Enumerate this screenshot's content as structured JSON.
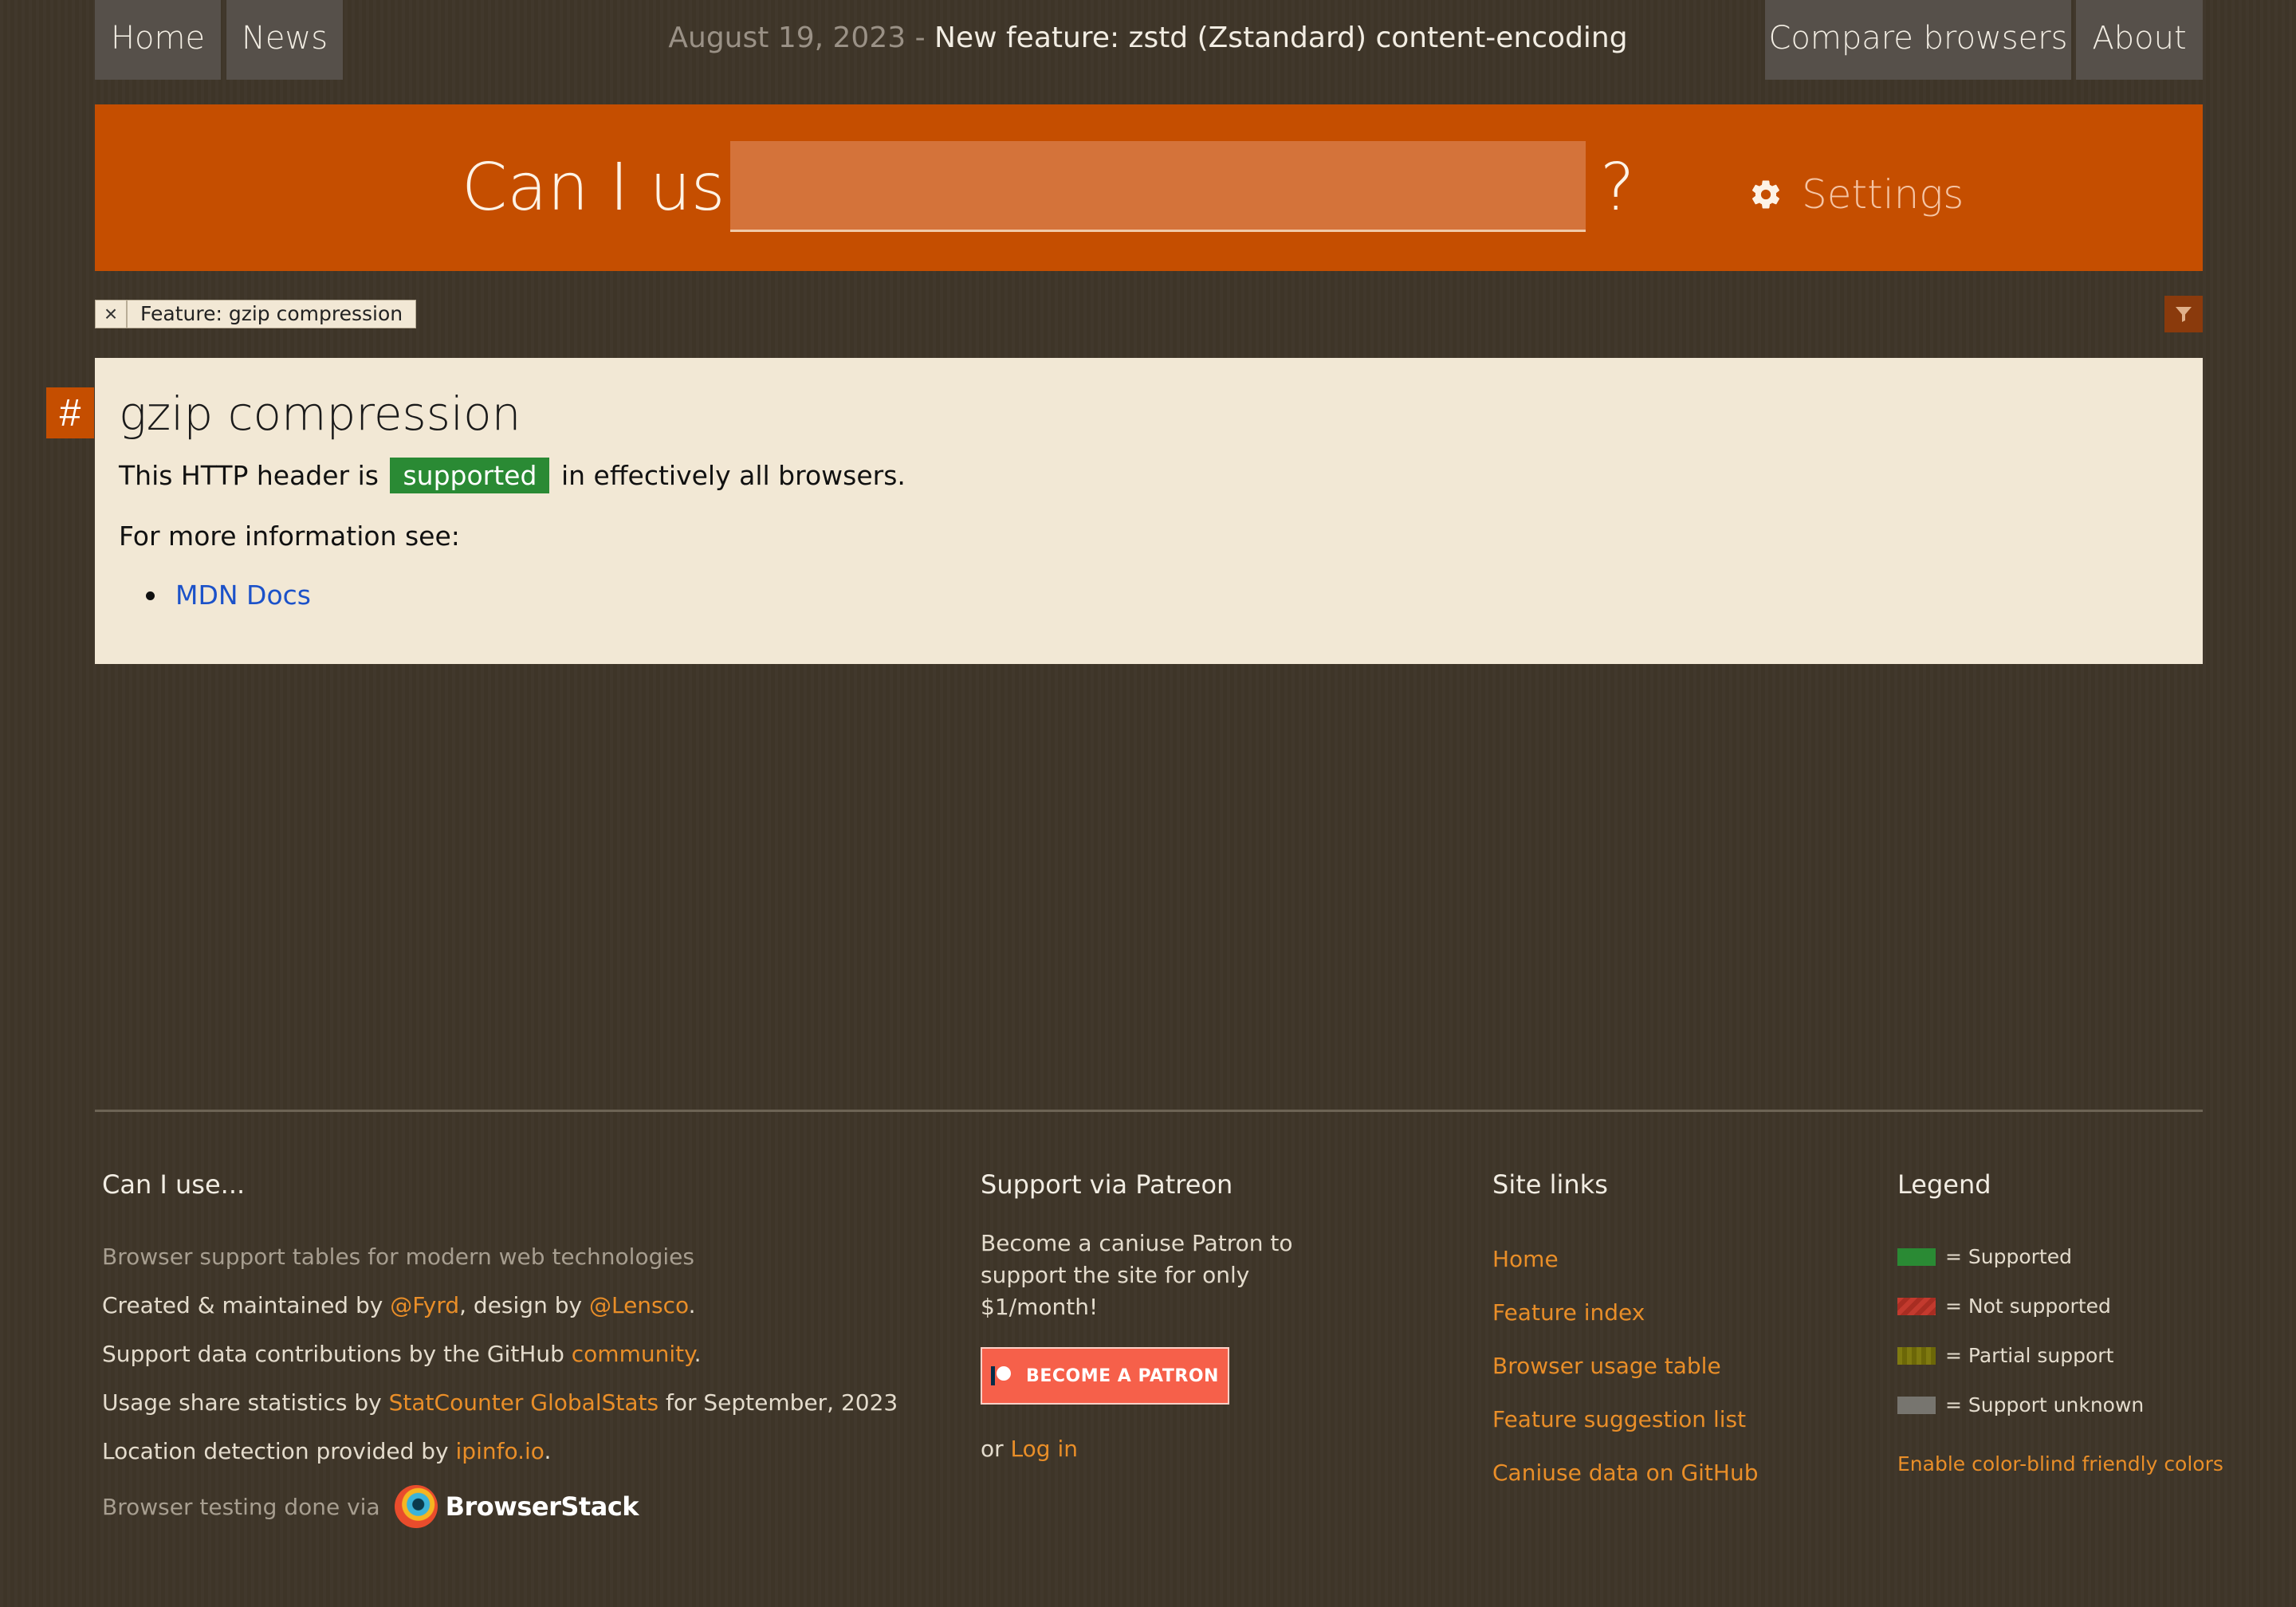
{
  "nav": {
    "home": "Home",
    "news": "News",
    "news_date": "August 19, 2023",
    "news_sep": " - ",
    "news_title": "New feature: zstd (Zstandard) content-encoding",
    "compare": "Compare browsers",
    "about": "About"
  },
  "search": {
    "label": "Can I use",
    "value": "",
    "question": "?",
    "settings": "Settings"
  },
  "filter": {
    "close": "×",
    "tag": "Feature: gzip compression"
  },
  "feature": {
    "anchor": "#",
    "title": "gzip compression",
    "desc_before": "This HTTP header is",
    "badge": "supported",
    "desc_after": "in effectively all browsers.",
    "more_info": "For more information see:",
    "links": [
      "MDN Docs"
    ]
  },
  "footer": {
    "caniuse": {
      "heading": "Can I use...",
      "tagline": "Browser support tables for modern web technologies",
      "created_prefix": "Created & maintained by ",
      "fyrd": "@Fyrd",
      "design_mid": ", design by ",
      "lensco": "@Lensco",
      "period": ".",
      "support_prefix": "Support data contributions by the GitHub ",
      "community": "community",
      "usage_prefix": "Usage share statistics by ",
      "statcounter": "StatCounter GlobalStats",
      "usage_suffix": " for September, 2023",
      "location_prefix": "Location detection provided by ",
      "ipinfo": "ipinfo.io",
      "testing": "Browser testing done via",
      "browserstack": "BrowserStack"
    },
    "patreon": {
      "heading": "Support via Patreon",
      "text": "Become a caniuse Patron to support the site for only $1/month!",
      "button": "BECOME A PATRON",
      "or": "or ",
      "login": "Log in"
    },
    "site_links": {
      "heading": "Site links",
      "items": [
        "Home",
        "Feature index",
        "Browser usage table",
        "Feature suggestion list",
        "Caniuse data on GitHub"
      ]
    },
    "legend": {
      "heading": "Legend",
      "items": [
        {
          "label": "= Supported",
          "color": "#2a8a34"
        },
        {
          "label": "= Not supported",
          "color": "#c33a2e"
        },
        {
          "label": "= Partial support",
          "color": "#7f7a10"
        },
        {
          "label": "= Support unknown",
          "color": "#77756f"
        }
      ],
      "colorblind": "Enable color-blind friendly colors"
    }
  },
  "colors": {
    "banner": "#c54e00",
    "link": "#e98e28",
    "supported": "#2a8a34"
  }
}
